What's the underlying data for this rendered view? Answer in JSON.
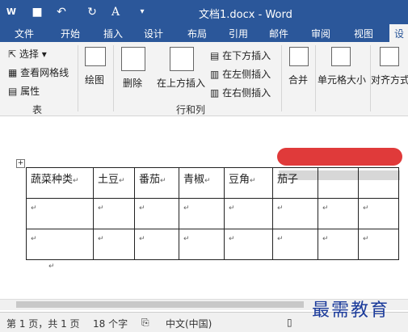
{
  "window": {
    "title": "文档1.docx - Word",
    "app_icon": "W",
    "quick_access": [
      "save-icon",
      "undo-icon",
      "redo-icon",
      "format-painter-icon",
      "customize-icon"
    ]
  },
  "tabs": [
    "文件",
    "开始",
    "插入",
    "设计",
    "布局",
    "引用",
    "邮件",
    "审阅",
    "视图",
    "设"
  ],
  "ribbon": {
    "table_group": {
      "select": "选择",
      "view_grid": "查看网格线",
      "properties": "属性",
      "label": "表"
    },
    "draw": "绘图",
    "delete": "删除",
    "insert_above": "在上方插入",
    "insert_below": "在下方插入",
    "insert_left": "在左侧插入",
    "insert_right": "在右侧插入",
    "rows_cols_label": "行和列",
    "merge": "合并",
    "cell_size": "单元格大小",
    "align": "对齐方式"
  },
  "table": {
    "headers": [
      "蔬菜种类",
      "土豆",
      "番茄",
      "青椒",
      "豆角",
      "茄子",
      "",
      "",
      ""
    ],
    "rows": 2,
    "cell_mark": "↵"
  },
  "status": {
    "page": "第 1 页，共 1 页",
    "words": "18 个字",
    "lang": "中文(中国)"
  },
  "watermark": "最需教育",
  "colors": {
    "accent": "#2b579a",
    "redaction": "#e03a3a"
  }
}
